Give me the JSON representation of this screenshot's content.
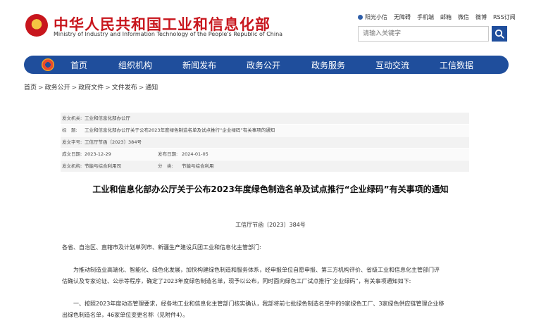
{
  "header": {
    "title": "中华人民共和国工业和信息化部",
    "subtitle": "Ministry of Industry and Information Technology of the People's Republic of China",
    "links": [
      "阳光小信",
      "无障碍",
      "手机端",
      "邮箱",
      "微信",
      "微博",
      "RSS订阅"
    ],
    "search_placeholder": "请输入关键字"
  },
  "nav": {
    "items": [
      "首页",
      "组织机构",
      "新闻发布",
      "政务公开",
      "政务服务",
      "互动交流",
      "工信数据"
    ]
  },
  "breadcrumb": [
    "首页",
    "政务公开",
    "政府文件",
    "文件发布",
    "通知"
  ],
  "meta": {
    "issuer_label": "发文机关:",
    "issuer": "工业和信息化部办公厅",
    "title_label": "标　题:",
    "title": "工业和信息化部办公厅关于公布2023年度绿色制造名单及试点推行“企业绿码”有关事项的通知",
    "docno_label": "发文字号:",
    "docno": "工信厅节函〔2023〕384号",
    "date_label": "成文日期:",
    "date": "2023-12-29",
    "pubdate_label": "发布日期:",
    "pubdate": "2024-01-05",
    "org_label": "发文机构:",
    "org": "节能与综合利用司",
    "cat_label": "分　类:",
    "cat": "节能与综合利用"
  },
  "article": {
    "title": "工业和信息化部办公厅关于公布2023年度绿色制造名单及试点推行“企业绿码”有关事项的通知",
    "docno": "工信厅节函〔2023〕384号",
    "salutation": "各省、自治区、直辖市及计划单列市、新疆生产建设兵团工业和信息化主管部门:",
    "p1_line1": "为推动制造业高端化、智能化、绿色化发展，加快构建绿色制造和服务体系，经申报单位自愿申报、第三方机构评价、省级工业和信息化主管部门评",
    "p1_line2": "估确认及专家论证、公示等程序，确定了2023年度绿色制造名单，现予以公布，同时面向绿色工厂试点推行“企业绿码”，有关事项通知如下:",
    "p2_line1": "一、按照2023年度动态管理要求，经各地工业和信息化主管部门核实确认，我部将前七批绿色制造名单中的9家绿色工厂、3家绿色供应链管理企业移",
    "p2_line2": "出绿色制造名单，46家单位变更名称（见附件4）。"
  }
}
